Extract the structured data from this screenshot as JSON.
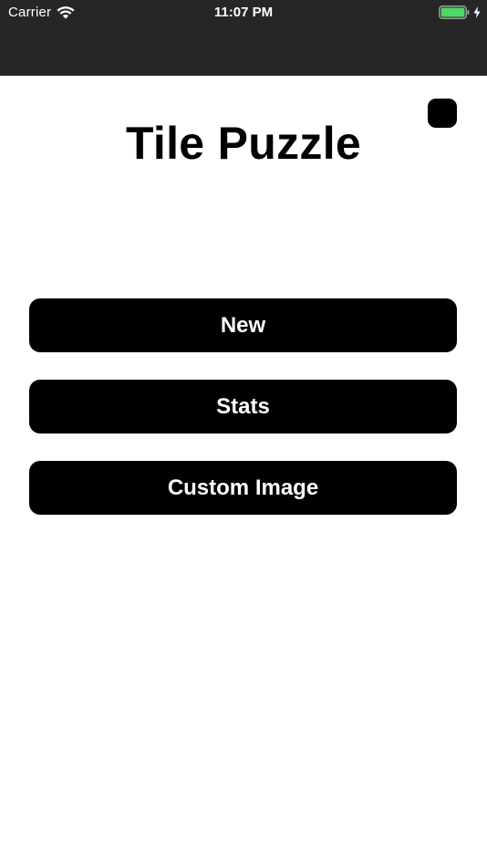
{
  "status_bar": {
    "carrier": "Carrier",
    "time": "11:07 PM",
    "wifi_icon": "wifi-icon",
    "battery_icon": "battery-icon",
    "charging_icon": "bolt-icon",
    "battery_color": "#4cd964"
  },
  "header": {
    "title": "Tile Puzzle",
    "corner_button_icon": "rounded-square-icon"
  },
  "menu": {
    "new_label": "New",
    "stats_label": "Stats",
    "custom_image_label": "Custom Image"
  },
  "colors": {
    "nav_background": "#262626",
    "button_background": "#000000",
    "button_text": "#ffffff",
    "page_background": "#ffffff"
  }
}
